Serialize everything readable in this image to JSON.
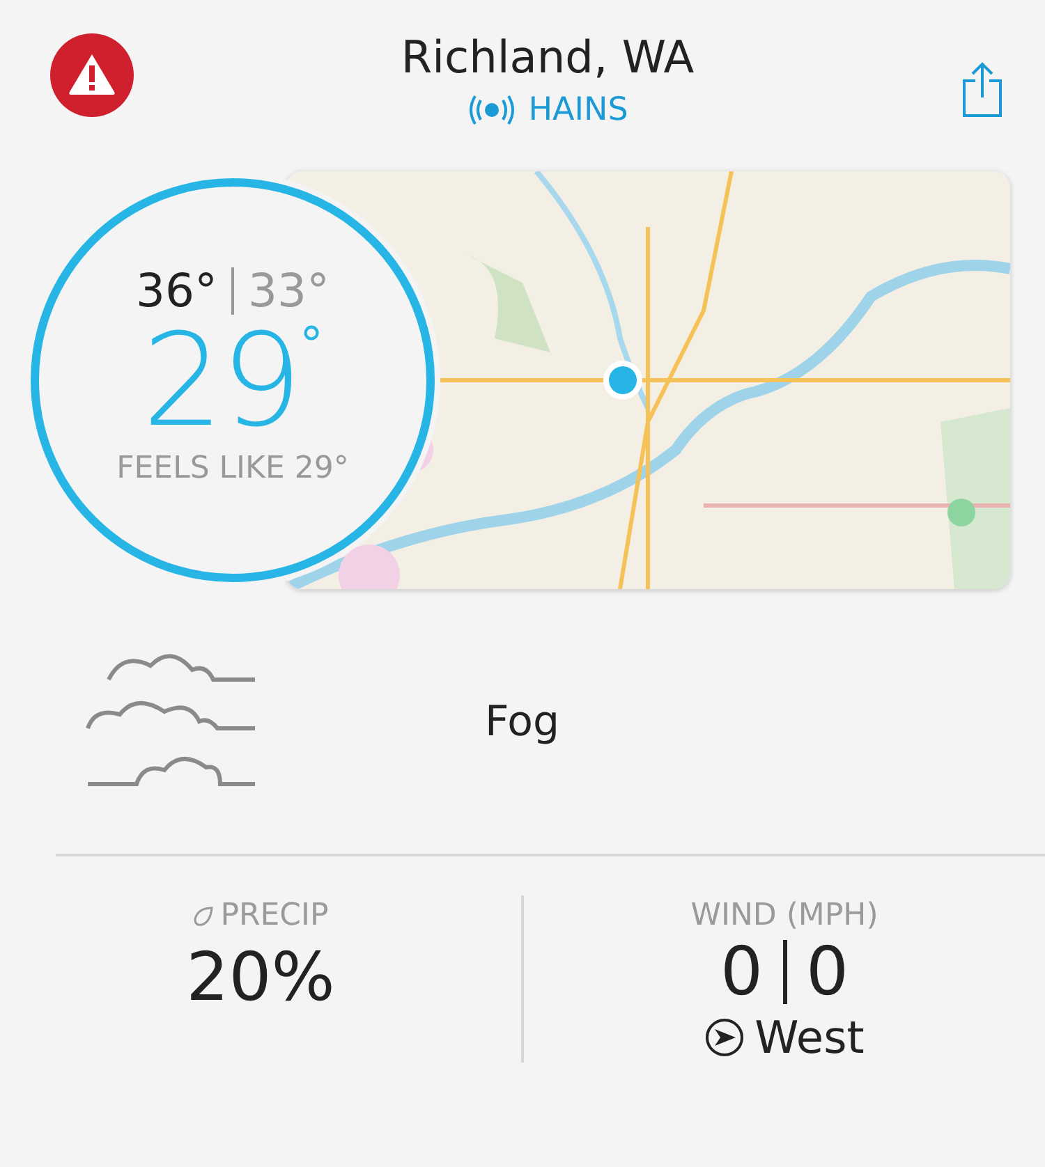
{
  "header": {
    "title": "Richland, WA",
    "station": "HAINS"
  },
  "current": {
    "high": "36°",
    "low": "33°",
    "temp": "29",
    "degree": "°",
    "feels_like": "FEELS LIKE 29°"
  },
  "condition": {
    "text": "Fog"
  },
  "precip": {
    "label": "PRECIP",
    "value": "20%"
  },
  "wind": {
    "label": "WIND (MPH)",
    "speed": "0",
    "gust": "0",
    "direction": "West"
  }
}
